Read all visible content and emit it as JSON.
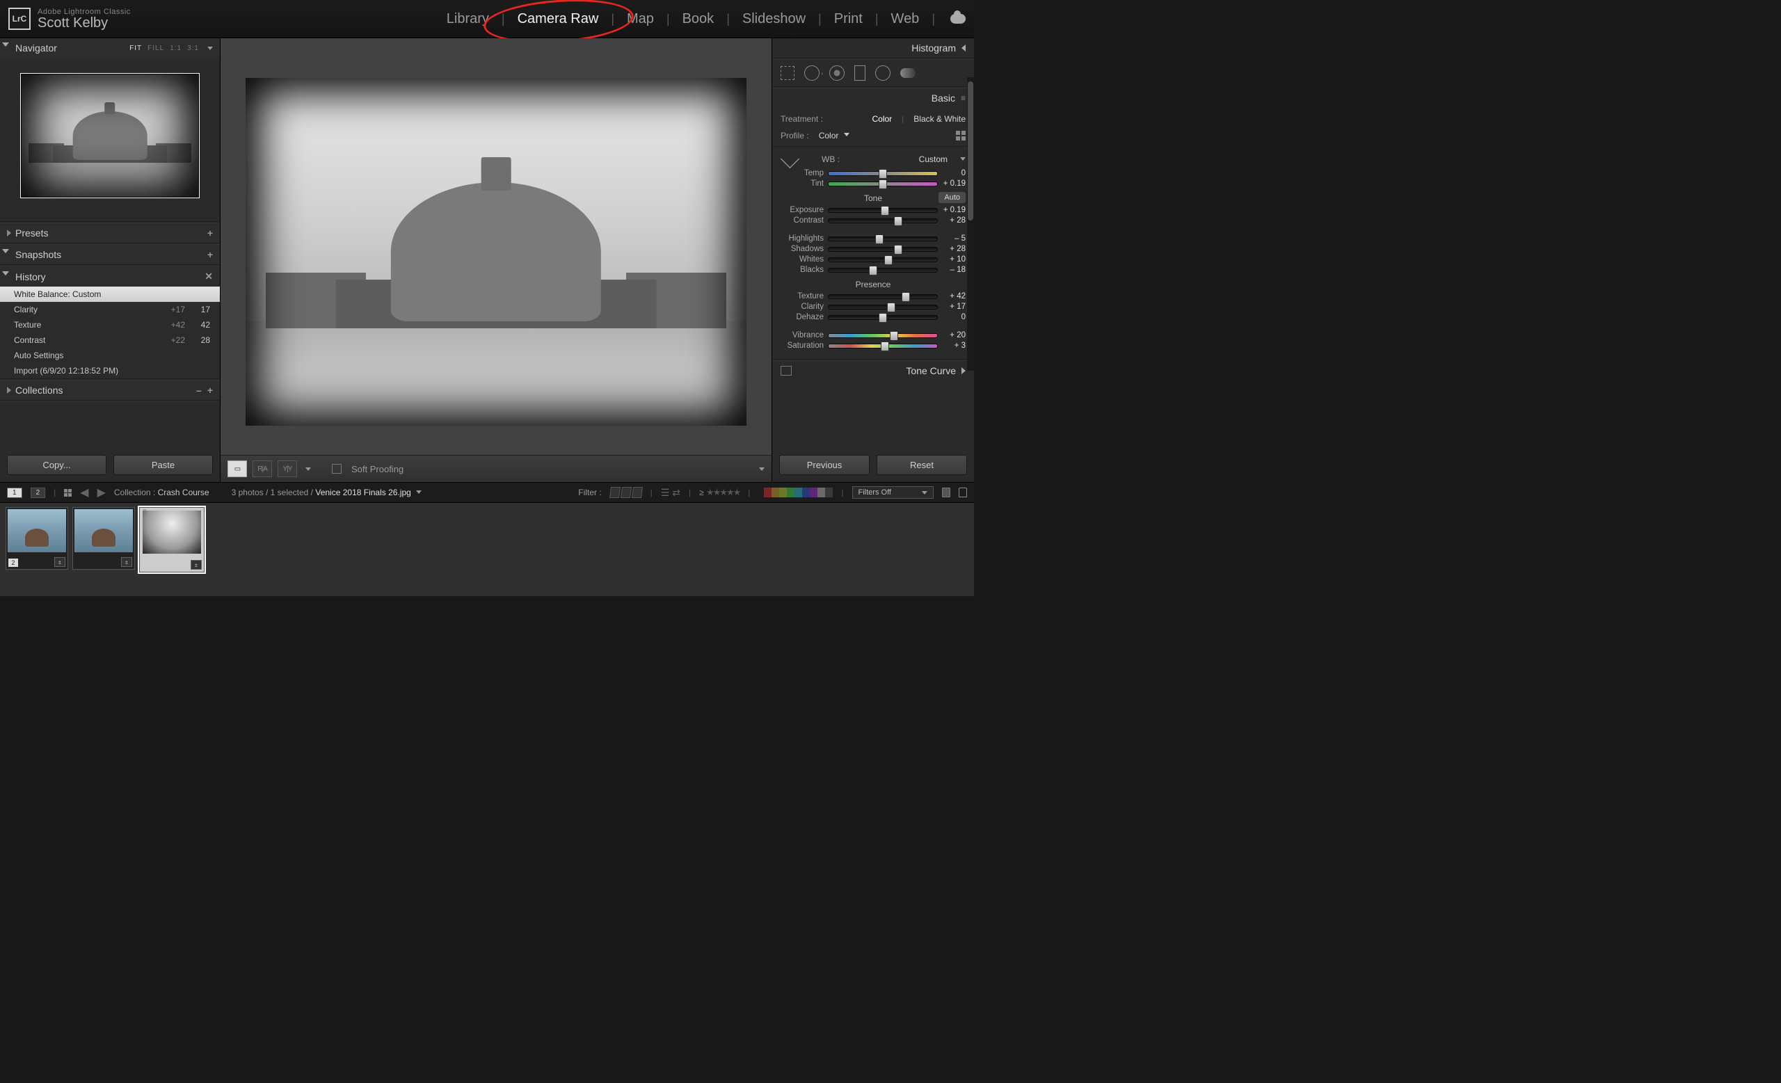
{
  "app": {
    "product_line": "Adobe Lightroom Classic",
    "identity_name": "Scott Kelby",
    "logo_text": "LrC"
  },
  "modules": {
    "items": [
      "Library",
      "Camera Raw",
      "Map",
      "Book",
      "Slideshow",
      "Print",
      "Web"
    ],
    "active_index": 1
  },
  "left_nav": {
    "navigator_label": "Navigator",
    "fit_label": "FIT",
    "fill_label": "FILL",
    "ratio1_label": "1:1",
    "ratio2_label": "3:1",
    "presets_label": "Presets",
    "snapshots_label": "Snapshots",
    "history_label": "History",
    "collections_label": "Collections",
    "copy_label": "Copy...",
    "paste_label": "Paste"
  },
  "history": [
    {
      "label": "White Balance: Custom",
      "prev": "",
      "val": "",
      "selected": true
    },
    {
      "label": "Clarity",
      "prev": "+17",
      "val": "17"
    },
    {
      "label": "Texture",
      "prev": "+42",
      "val": "42"
    },
    {
      "label": "Contrast",
      "prev": "+22",
      "val": "28"
    },
    {
      "label": "Auto Settings",
      "prev": "",
      "val": ""
    },
    {
      "label": "Import (6/9/20 12:18:52 PM)",
      "prev": "",
      "val": ""
    }
  ],
  "center": {
    "soft_proofing_label": "Soft Proofing",
    "compare_ra": "R|A",
    "compare_yy": "Y|Y"
  },
  "right": {
    "histogram_label": "Histogram",
    "basic_label": "Basic",
    "tone_curve_label": "Tone Curve",
    "treatment_label": "Treatment :",
    "treatment_color": "Color",
    "treatment_bw": "Black & White",
    "profile_label": "Profile :",
    "profile_value": "Color",
    "wb_label": "WB :",
    "wb_value": "Custom",
    "tone_heading": "Tone",
    "auto_label": "Auto",
    "presence_heading": "Presence",
    "previous_label": "Previous",
    "reset_label": "Reset"
  },
  "sliders": {
    "temp": {
      "label": "Temp",
      "value": "0",
      "pos": 50
    },
    "tint": {
      "label": "Tint",
      "value": "+ 0.19",
      "pos": 50
    },
    "exposure": {
      "label": "Exposure",
      "value": "+ 0.19",
      "pos": 52
    },
    "contrast": {
      "label": "Contrast",
      "value": "+ 28",
      "pos": 64
    },
    "highlights": {
      "label": "Highlights",
      "value": "– 5",
      "pos": 47
    },
    "shadows": {
      "label": "Shadows",
      "value": "+ 28",
      "pos": 64
    },
    "whites": {
      "label": "Whites",
      "value": "+ 10",
      "pos": 55
    },
    "blacks": {
      "label": "Blacks",
      "value": "– 18",
      "pos": 41
    },
    "texture": {
      "label": "Texture",
      "value": "+ 42",
      "pos": 71
    },
    "clarity": {
      "label": "Clarity",
      "value": "+ 17",
      "pos": 58
    },
    "dehaze": {
      "label": "Dehaze",
      "value": "0",
      "pos": 50
    },
    "vibrance": {
      "label": "Vibrance",
      "value": "+ 20",
      "pos": 60
    },
    "saturation": {
      "label": "Saturation",
      "value": "+ 3",
      "pos": 52
    }
  },
  "footer": {
    "page1": "1",
    "page2": "2",
    "collection_prefix": "Collection : ",
    "collection_name": "Crash Course",
    "count_text": "3 photos / 1 selected / ",
    "filename": "Venice 2018 Finals 26.jpg",
    "filter_label": "Filter :",
    "filters_off_label": "Filters Off"
  },
  "filmstrip": {
    "items": [
      {
        "idx": "1",
        "stack": "2",
        "bw": false
      },
      {
        "idx": "2",
        "stack": "",
        "bw": false
      },
      {
        "idx": "3",
        "stack": "",
        "bw": true,
        "active": true
      }
    ]
  },
  "colors": {
    "swatches": [
      "#7a2626",
      "#7a6026",
      "#6b7a26",
      "#2f7a2f",
      "#266b7a",
      "#26397a",
      "#5d267a",
      "#6a6a6a",
      "#3a3a3a"
    ]
  }
}
